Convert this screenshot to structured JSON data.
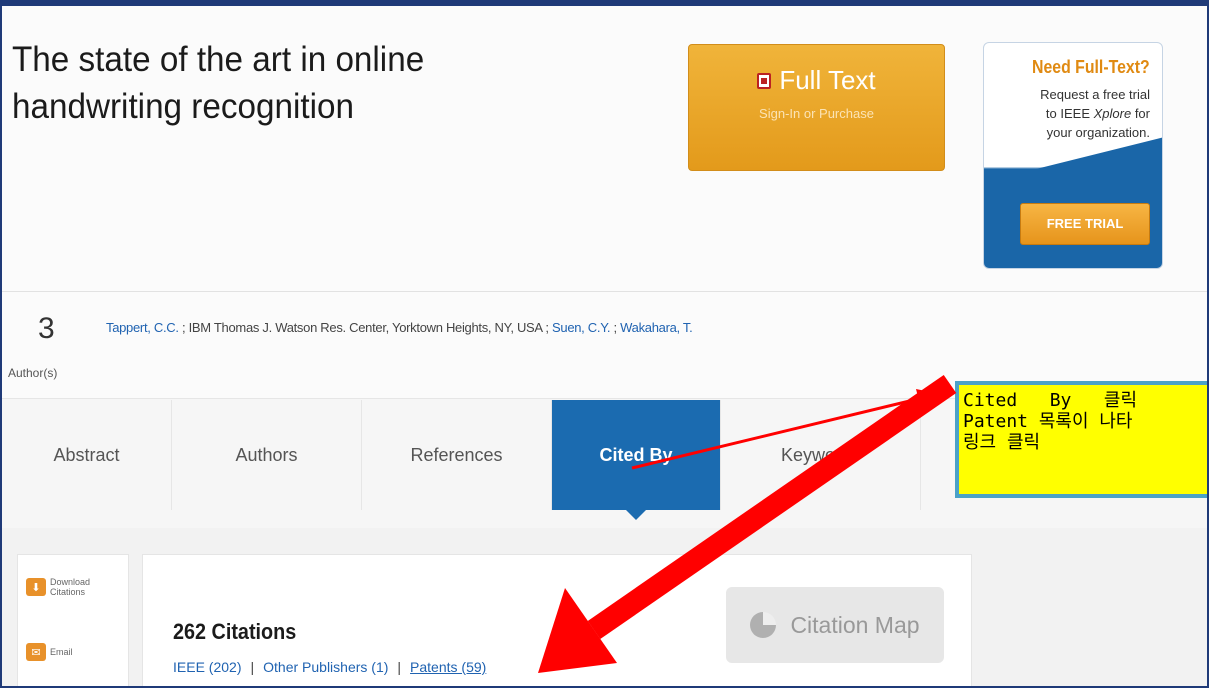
{
  "article": {
    "title_line1": "The state of the art in online",
    "title_line2": "handwriting recognition"
  },
  "fulltext": {
    "label": "Full Text",
    "sub": "Sign-In or Purchase"
  },
  "trial": {
    "heading": "Need Full-Text?",
    "line1": "Request a free trial",
    "line2a": "to IEEE ",
    "line2b": "Xplore",
    "line2c": " for",
    "line3": "your organization.",
    "button": "FREE TRIAL"
  },
  "authors": {
    "count": "3",
    "label": "Author(s)",
    "author1": "Tappert, C.C.",
    "affiliation": " ; IBM Thomas J. Watson Res. Center, Yorktown Heights, NY, USA ; ",
    "author2": "Suen, C.Y.",
    "sep": " ; ",
    "author3": "Wakahara, T."
  },
  "tabs": [
    "Abstract",
    "Authors",
    "References",
    "Cited By",
    "Keywords"
  ],
  "sidebar": {
    "download_1": "Download",
    "download_2": "Citations",
    "email": "Email"
  },
  "citations": {
    "count_label": "262 Citations",
    "ieee": "IEEE (202)",
    "other": "Other Publishers (1)",
    "patents": "Patents (59)",
    "sep": "|",
    "map_label": "Citation Map"
  },
  "callout": {
    "line1": "Cited   By   클릭",
    "line2": "Patent 목록이 나타",
    "line3": "링크 클릭"
  },
  "colors": {
    "accent_blue": "#1b6bb0",
    "orange": "#e39a1b",
    "callout_bg": "#ffff00",
    "arrow": "#ff0000"
  }
}
